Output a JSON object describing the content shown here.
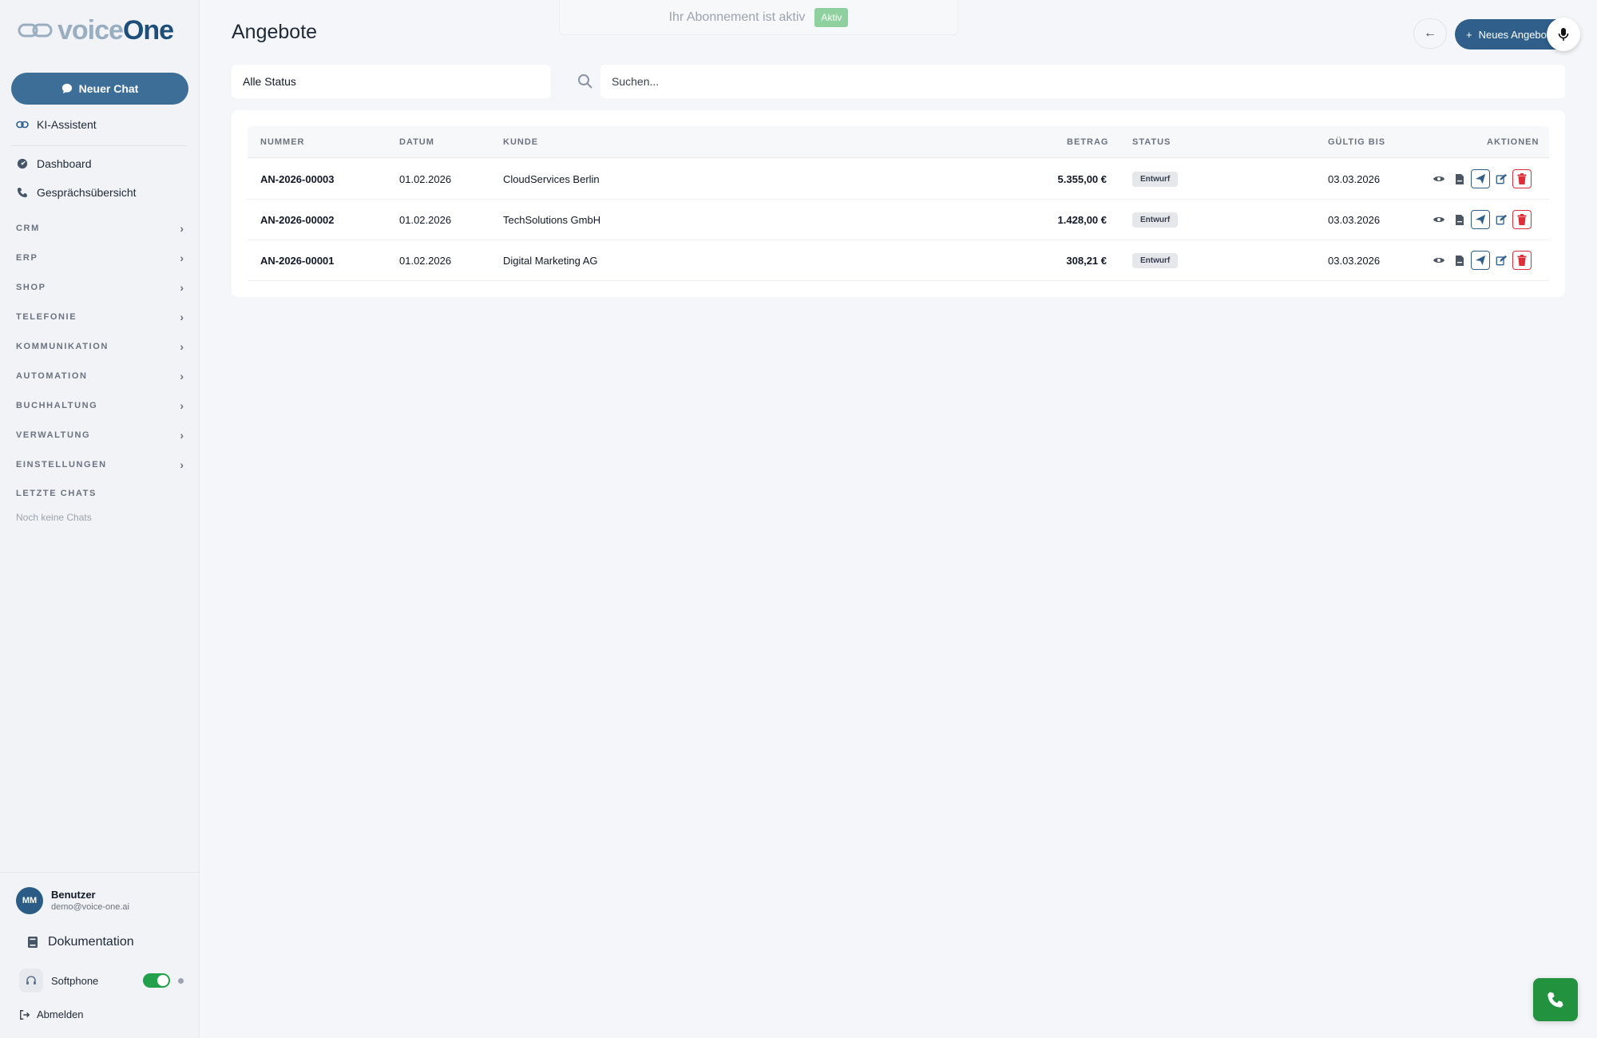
{
  "app": {
    "logo_light": "voice",
    "logo_bold": "One"
  },
  "sidebar": {
    "new_chat_label": "Neuer Chat",
    "assistant_label": "KI-Assistent",
    "nav": [
      {
        "label": "Dashboard",
        "icon": "dashboard-icon"
      },
      {
        "label": "Gesprächsübersicht",
        "icon": "phone-icon"
      }
    ],
    "sections": [
      "CRM",
      "ERP",
      "SHOP",
      "TELEFONIE",
      "KOMMUNIKATION",
      "AUTOMATION",
      "BUCHHALTUNG",
      "VERWALTUNG",
      "EINSTELLUNGEN"
    ],
    "recent_chats_label": "LETZTE CHATS",
    "no_chats_text": "Noch keine Chats",
    "user": {
      "initials": "MM",
      "name": "Benutzer",
      "email": "demo@voice-one.ai"
    },
    "documentation_label": "Dokumentation",
    "softphone_label": "Softphone",
    "softphone_enabled": true,
    "logout_label": "Abmelden"
  },
  "header": {
    "title": "Angebote",
    "banner_text": "Ihr Abonnement ist aktiv",
    "banner_badge": "Aktiv",
    "new_offer_label": "Neues Angebot"
  },
  "filters": {
    "status_value": "Alle Status",
    "search_placeholder": "Suchen..."
  },
  "table": {
    "columns": [
      "NUMMER",
      "DATUM",
      "KUNDE",
      "BETRAG",
      "STATUS",
      "GÜLTIG BIS",
      "AKTIONEN"
    ],
    "rows": [
      {
        "number": "AN-2026-00003",
        "date": "01.02.2026",
        "customer": "CloudServices Berlin",
        "amount": "5.355,00 €",
        "status": "Entwurf",
        "valid_until": "03.03.2026"
      },
      {
        "number": "AN-2026-00002",
        "date": "01.02.2026",
        "customer": "TechSolutions GmbH",
        "amount": "1.428,00 €",
        "status": "Entwurf",
        "valid_until": "03.03.2026"
      },
      {
        "number": "AN-2026-00001",
        "date": "01.02.2026",
        "customer": "Digital Marketing AG",
        "amount": "308,21 €",
        "status": "Entwurf",
        "valid_until": "03.03.2026"
      }
    ]
  },
  "colors": {
    "primary": "#2f5f8a",
    "success": "#22923f",
    "danger": "#dc2f3a",
    "badge_green": "#8fd19e"
  }
}
